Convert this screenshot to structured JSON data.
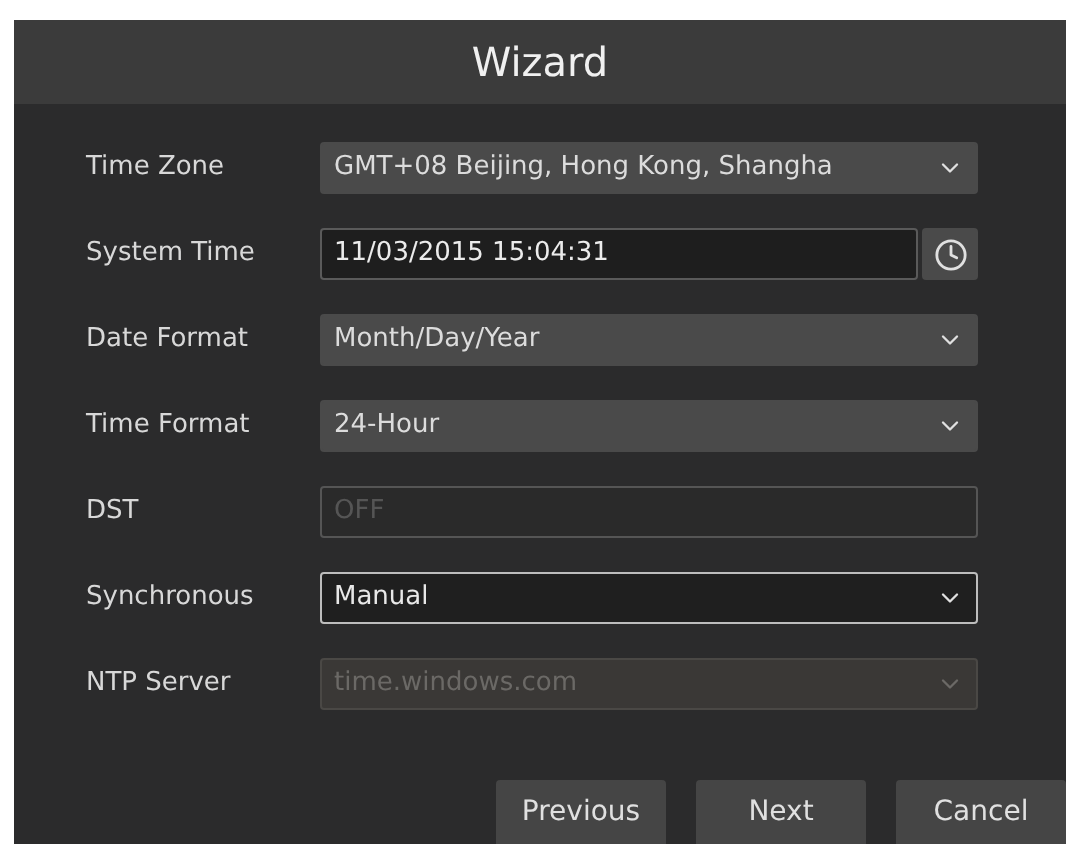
{
  "window": {
    "title": "Wizard"
  },
  "fields": [
    {
      "label": "Time Zone",
      "kind": "select",
      "value": "GMT+08 Beijing, Hong Kong, Shangha",
      "disabled": false,
      "focused": false
    },
    {
      "label": "System Time",
      "kind": "datetime",
      "value": "11/03/2015 15:04:31",
      "disabled": false,
      "focused": false
    },
    {
      "label": "Date Format",
      "kind": "select",
      "value": "Month/Day/Year",
      "disabled": false,
      "focused": false
    },
    {
      "label": "Time Format",
      "kind": "select",
      "value": "24-Hour",
      "disabled": false,
      "focused": false
    },
    {
      "label": "DST",
      "kind": "text",
      "value": "OFF",
      "disabled": true,
      "focused": false
    },
    {
      "label": "Synchronous",
      "kind": "select",
      "value": "Manual",
      "disabled": false,
      "focused": true
    },
    {
      "label": "NTP Server",
      "kind": "select",
      "value": "time.windows.com",
      "disabled": true,
      "focused": false
    }
  ],
  "buttons": [
    "Previous",
    "Next",
    "Cancel"
  ]
}
